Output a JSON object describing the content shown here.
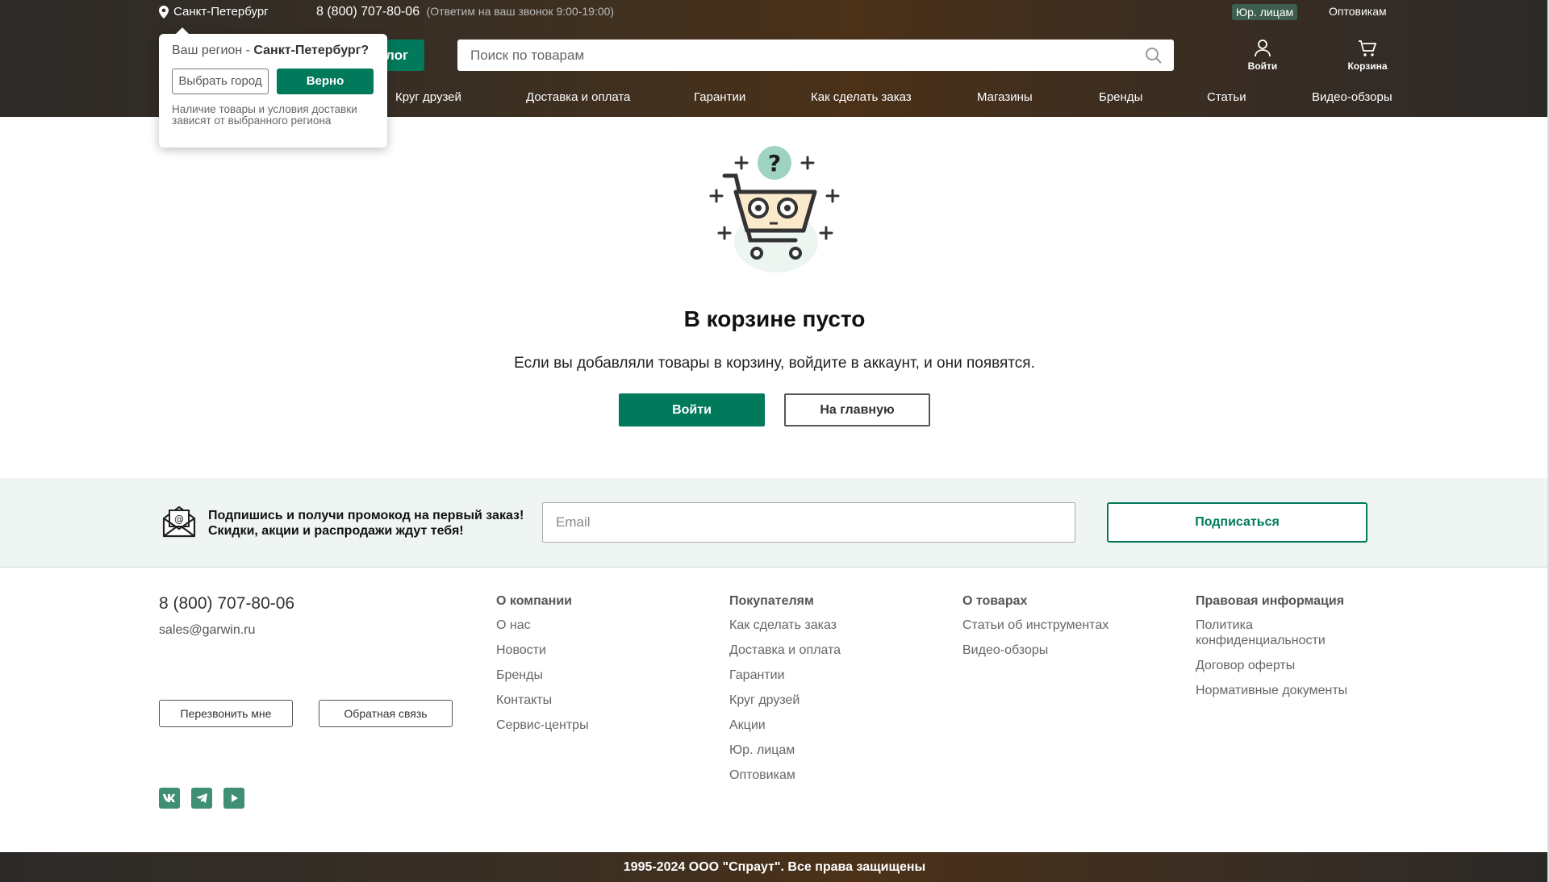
{
  "topbar": {
    "city": "Санкт-Петербург",
    "phone": "8 (800) 707-80-06",
    "phone_note": "(Ответим на ваш звонок 9:00-19:00)",
    "legal": "Юр. лицам",
    "wholesale": "Оптовикам"
  },
  "header": {
    "catalog_label": "лог",
    "search_placeholder": "Поиск по товарам",
    "login_label": "Войти",
    "cart_label": "Корзина"
  },
  "nav": {
    "items": [
      "Круг друзей",
      "Доставка и оплата",
      "Гарантии",
      "Как сделать заказ",
      "Магазины",
      "Бренды",
      "Статьи",
      "Видео-обзоры"
    ]
  },
  "region_popup": {
    "question_prefix": "Ваш регион - ",
    "city": "Санкт-Петербург?",
    "choose_label": "Выбрать город",
    "ok_label": "Верно",
    "note": "Наличие товары и условия доставки зависят от выбранного региона"
  },
  "empty_cart": {
    "title": "В корзине пусто",
    "description": "Если вы добавляли товары в корзину, войдите в аккаунт, и они появятся.",
    "login_label": "Войти",
    "home_label": "На главную"
  },
  "subscribe": {
    "line1": "Подпишись и получи промокод на первый заказ!",
    "line2": "Скидки, акции и распродажи ждут тебя!",
    "email_placeholder": "Email",
    "button_label": "Подписаться"
  },
  "footer": {
    "phone": "8 (800) 707-80-06",
    "email": "sales@garwin.ru",
    "callback_label": "Перезвонить мне",
    "feedback_label": "Обратная связь",
    "socials": [
      "vk-icon",
      "telegram-icon",
      "youtube-icon"
    ],
    "columns": [
      {
        "title": "О компании",
        "links": [
          "О нас",
          "Новости",
          "Бренды",
          "Контакты",
          "Сервис-центры"
        ]
      },
      {
        "title": "Покупателям",
        "links": [
          "Как сделать заказ",
          "Доставка и оплата",
          "Гарантии",
          "Круг друзей",
          "Акции",
          "Юр. лицам",
          "Оптовикам"
        ]
      },
      {
        "title": "О товарах",
        "links": [
          "Статьи об инструментах",
          "Видео-обзоры"
        ]
      },
      {
        "title": "Правовая информация",
        "links": [
          "Политика конфиденциальности",
          "Договор оферты",
          "Нормативные документы"
        ]
      }
    ],
    "copyright": "1995-2024 ООО \"Спраут\". Все права защищены"
  },
  "colors": {
    "accent": "#007a5b",
    "subscribe_bg": "#eef5f2"
  }
}
